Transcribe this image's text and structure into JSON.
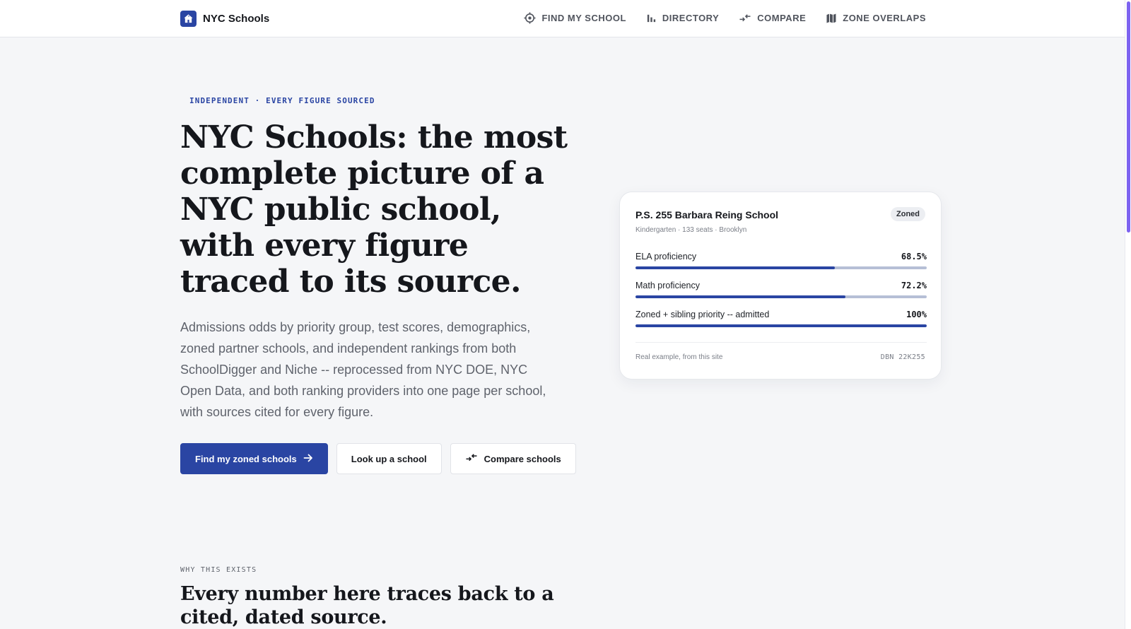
{
  "brand": {
    "name": "NYC Schools",
    "logo_icon": "school-house-icon",
    "accent": "#2a45a3"
  },
  "nav": [
    {
      "label": "FIND MY SCHOOL",
      "icon": "target-icon"
    },
    {
      "label": "DIRECTORY",
      "icon": "bar-chart-icon"
    },
    {
      "label": "COMPARE",
      "icon": "compare-arrows-icon"
    },
    {
      "label": "ZONE OVERLAPS",
      "icon": "map-icon"
    }
  ],
  "hero": {
    "eyebrow": "INDEPENDENT · EVERY FIGURE SOURCED",
    "title": "NYC Schools: the most complete picture of a NYC public school, with every figure traced to its source.",
    "subtitle": "Admissions odds by priority group, test scores, demographics, zoned partner schools, and independent rankings from both SchoolDigger and Niche -- reprocessed from NYC DOE, NYC Open Data, and both ranking providers into one page per school, with sources cited for every figure.",
    "buttons": {
      "primary": "Find my zoned schools",
      "lookup": "Look up a school",
      "compare": "Compare schools"
    }
  },
  "card": {
    "school_name": "P.S. 255 Barbara Reing School",
    "badge": "Zoned",
    "meta": "Kindergarten · 133 seats · Brooklyn",
    "metrics": [
      {
        "label": "ELA proficiency",
        "value": "68.5%",
        "fraction": 0.685
      },
      {
        "label": "Math proficiency",
        "value": "72.2%",
        "fraction": 0.722
      },
      {
        "label": "Zoned + sibling priority -- admitted",
        "value": "100%",
        "fraction": 1.0
      }
    ],
    "footer_left": "Real example, from this site",
    "footer_right": "DBN 22K255"
  },
  "section": {
    "eyebrow": "WHY THIS EXISTS",
    "title": "Every number here traces back to a cited, dated source."
  }
}
